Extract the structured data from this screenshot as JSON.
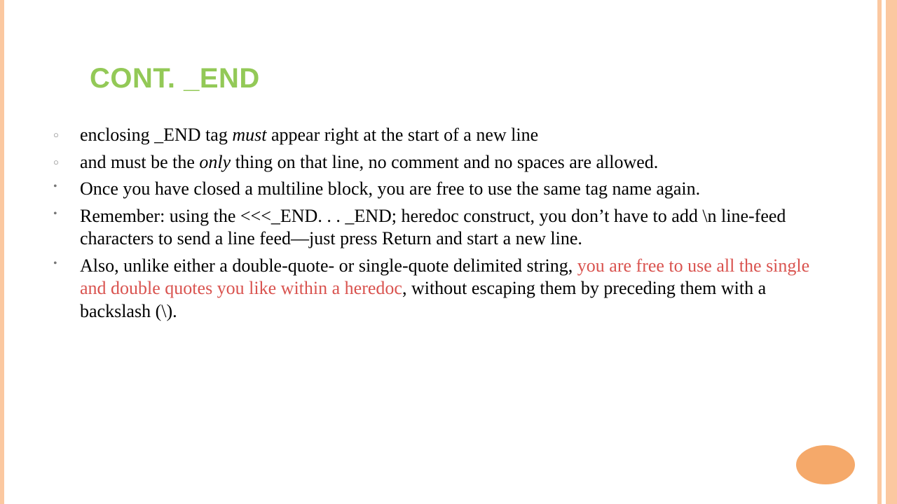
{
  "title": "CONT. _END",
  "bullets": [
    {
      "type": "circle",
      "spans": [
        {
          "t": "enclosing _END tag "
        },
        {
          "t": "must",
          "em": true
        },
        {
          "t": " appear right at the start of a new line"
        }
      ]
    },
    {
      "type": "circle",
      "spans": [
        {
          "t": "and must be the "
        },
        {
          "t": "only",
          "em": true
        },
        {
          "t": " thing on that line, no comment and no spaces are allowed."
        }
      ]
    },
    {
      "type": "dot",
      "spans": [
        {
          "t": "Once you have closed a multiline block, you are free to use the same tag name again."
        }
      ]
    },
    {
      "type": "dot",
      "spans": [
        {
          "t": "Remember: using the <<<_END. . . _END; heredoc construct, you don’t have to add \\n line-feed characters to send a line feed—just press Return and start a new line."
        }
      ]
    },
    {
      "type": "dot",
      "spans": [
        {
          "t": "Also, unlike either a double-quote- or single-quote delimited string, "
        },
        {
          "t": "you are free to use all the single and double quotes you like within a heredoc",
          "hl": true
        },
        {
          "t": ", without escaping them by preceding them with a backslash (\\)."
        }
      ]
    }
  ]
}
